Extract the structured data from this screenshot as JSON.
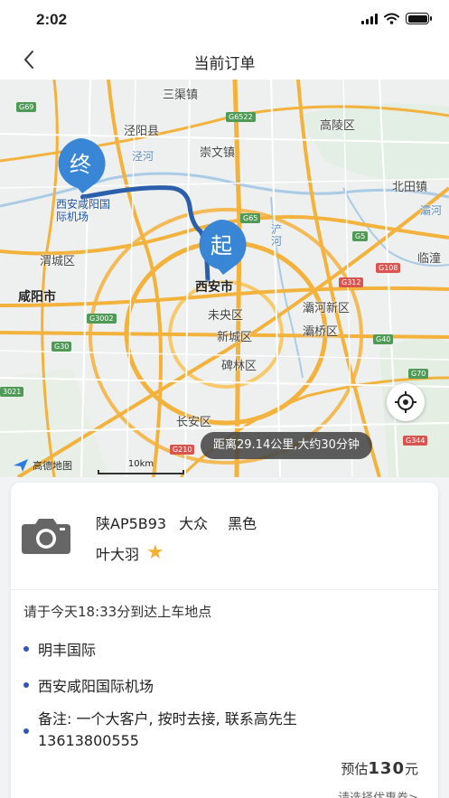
{
  "status_bar": {
    "time": "2:02"
  },
  "nav": {
    "title": "当前订单"
  },
  "map": {
    "labels": {
      "sanqu": "三渠镇",
      "jingyang": "泾阳县",
      "jinghe": "泾河",
      "chongwen": "崇文镇",
      "gaoling": "高陵区",
      "beitian": "北田镇",
      "bahe": "灞河",
      "chanhe": "浐河",
      "lintong": "临潼",
      "weicheng": "渭城区",
      "xianyang": "咸阳市",
      "xian": "西安市",
      "weiyang": "未央区",
      "baqiao_new": "灞河新区",
      "baqiao": "灞桥区",
      "xincheng": "新城区",
      "beilin": "碑林区",
      "changan": "长安区",
      "airport": "西安咸阳国际机场"
    },
    "shields": [
      "G69",
      "G6522",
      "G65",
      "G5",
      "G108",
      "G312",
      "G3002",
      "G40",
      "G30",
      "G70",
      "3021",
      "G210",
      "G344"
    ],
    "start_pin": "起",
    "end_pin": "终",
    "distance_text": "距离29.14公里,大约30分钟",
    "logo": "高德地图",
    "scale": "10km",
    "colors": {
      "route": "#2b5fab",
      "pin": "#3a86d6",
      "highway": "#f3b23c"
    }
  },
  "order": {
    "plate": "陕AP5B93",
    "brand": "大众",
    "color": "黑色",
    "driver": "叶大羽",
    "arrive_text": "请于今天18:33分到达上车地点",
    "stops": [
      "明丰国际",
      "西安咸阳国际机场"
    ],
    "note_line1": "备注: 一个大客户, 按时去接, 联系高先生",
    "note_line2": "13613800555",
    "estimate_label": "预估",
    "estimate_amount": "130",
    "estimate_unit": "元",
    "coupon_text": "请选择优惠券>"
  },
  "icons": [
    "back-chevron-icon",
    "camera-icon",
    "star-icon",
    "locate-icon",
    "gaode-logo-icon",
    "signal-icon",
    "wifi-icon",
    "battery-icon"
  ]
}
